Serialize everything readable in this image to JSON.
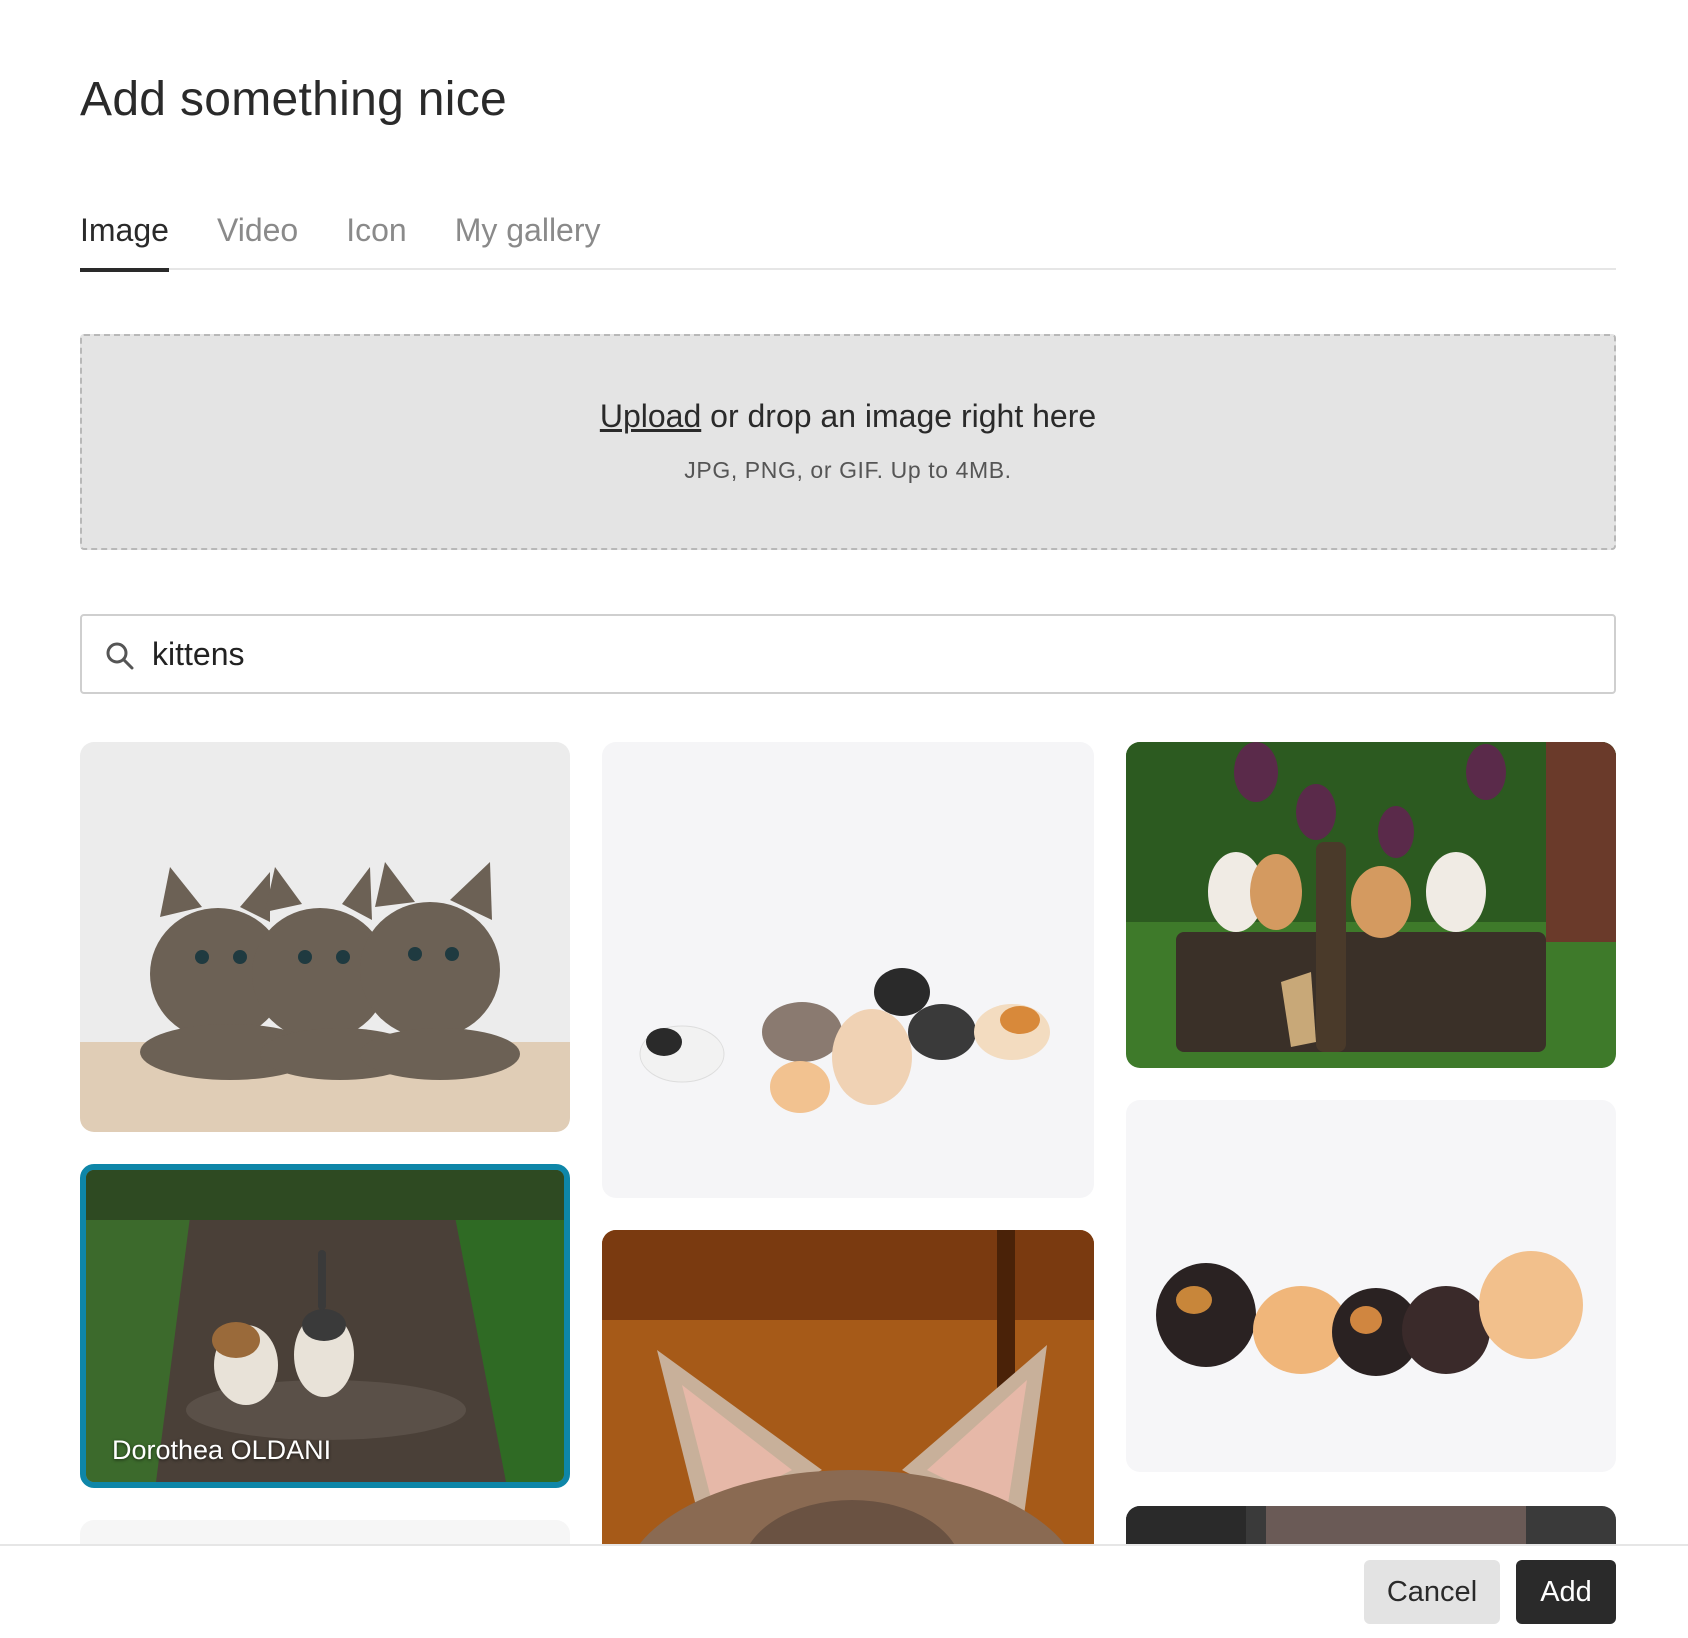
{
  "dialog": {
    "title": "Add something nice"
  },
  "tabs": [
    {
      "label": "Image",
      "active": true
    },
    {
      "label": "Video",
      "active": false
    },
    {
      "label": "Icon",
      "active": false
    },
    {
      "label": "My gallery",
      "active": false
    }
  ],
  "dropzone": {
    "upload_link": "Upload",
    "main_rest": " or drop an image right here",
    "hint": "JPG, PNG, or GIF. Up to 4MB."
  },
  "search": {
    "icon": "search-icon",
    "value": "kittens"
  },
  "results": [
    {
      "subject": "three tabby kittens on a floor"
    },
    {
      "subject": "group of kittens on white background"
    },
    {
      "subject": "kittens in a wicker basket on grass"
    },
    {
      "subject": "two kittens walking on a dirt path",
      "credit": "Dorothea OLDANI",
      "selected": true
    },
    {
      "subject": "close-up of a tabby kitten's ears"
    },
    {
      "subject": "five kittens in a row on white background"
    }
  ],
  "footer": {
    "cancel_label": "Cancel",
    "add_label": "Add"
  },
  "colors": {
    "selection_border": "#0e86a8",
    "primary_button": "#2a2a2a",
    "secondary_button": "#e3e3e3",
    "dropzone_bg": "#e4e4e4"
  }
}
